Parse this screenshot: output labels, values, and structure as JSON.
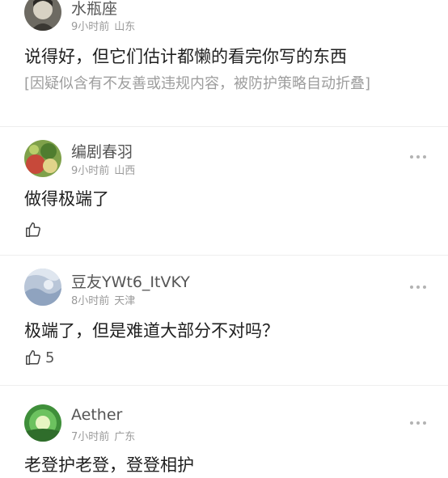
{
  "comments": [
    {
      "username": "水瓶座",
      "time": "9小时前",
      "location": "山东",
      "text": "说得好，但它们估计都懒的看完你写的东西",
      "folded_notice": "[因疑似含有不友善或违规内容，被防护策略自动折叠]"
    },
    {
      "username": "编剧春羽",
      "time": "9小时前",
      "location": "山西",
      "text": "做得极端了",
      "likes": ""
    },
    {
      "username": "豆友YWt6_ItVKY",
      "time": "8小时前",
      "location": "天津",
      "text": "极端了，但是难道大部分不对吗？",
      "likes": "5"
    },
    {
      "username": "Aether",
      "time": "7小时前",
      "location": "广东",
      "text": "老登护老登，登登相护"
    }
  ],
  "icons": {
    "like": "thumbs-up-icon",
    "more": "more-dots-icon"
  },
  "colors": {
    "username": "#555555",
    "meta": "#9a9a9a",
    "folded": "#9d9d9d",
    "divider": "#eeeeee"
  }
}
